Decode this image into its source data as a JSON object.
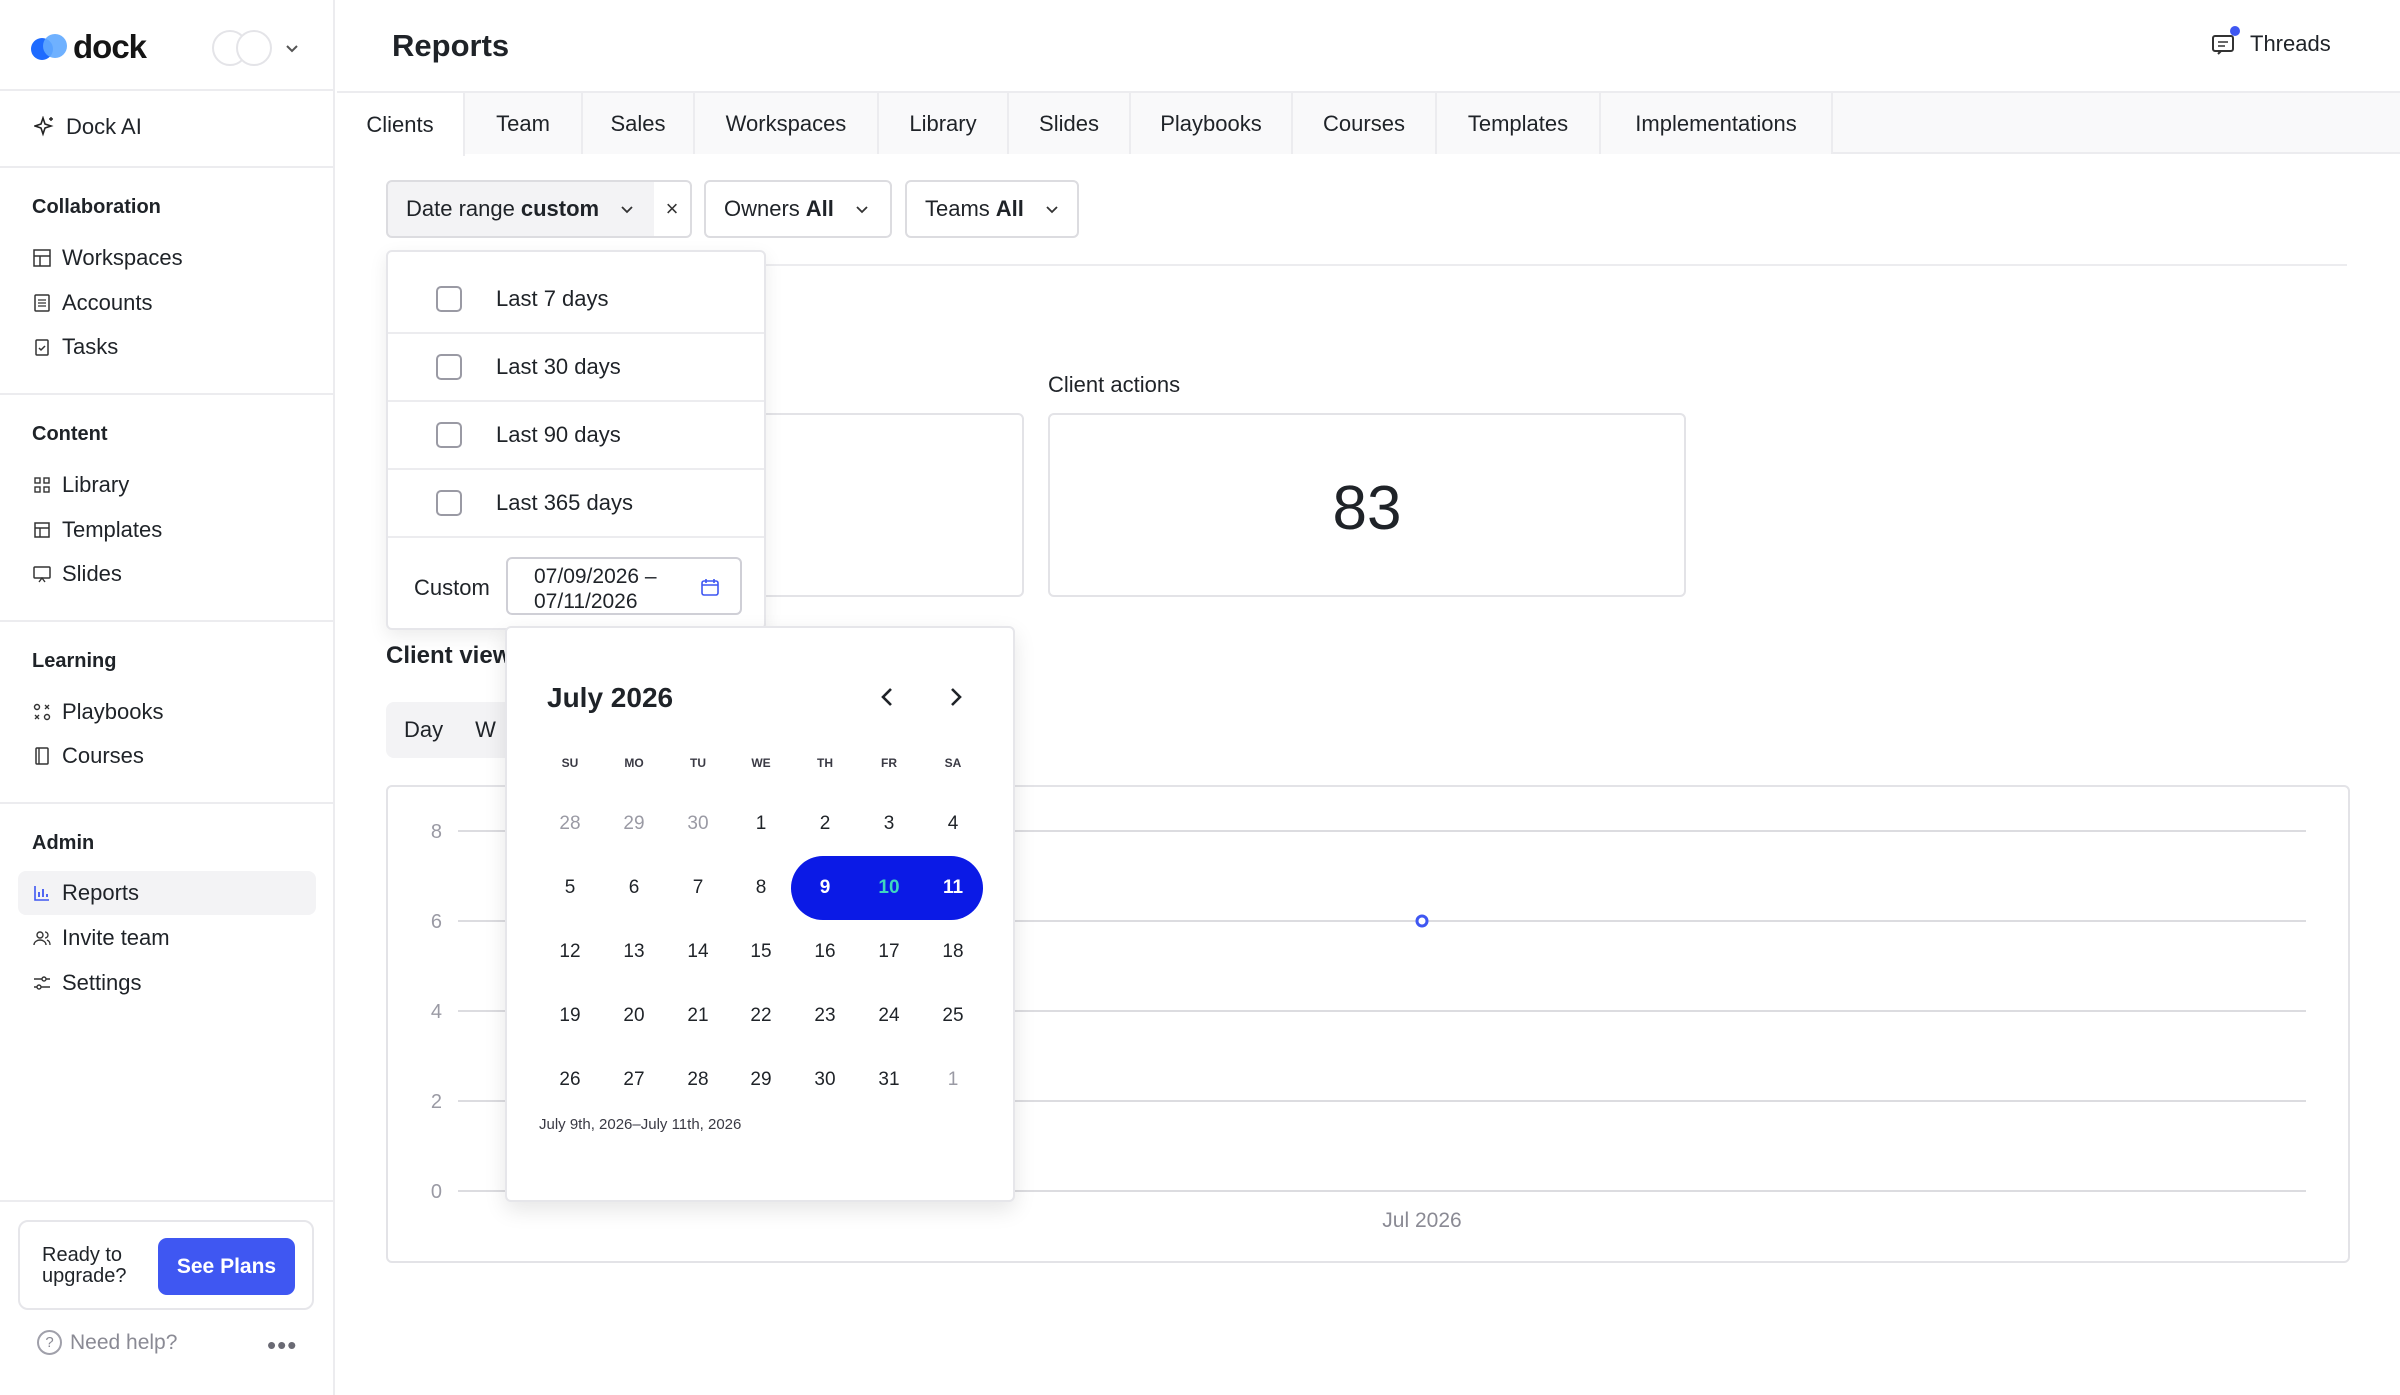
{
  "brand": {
    "name": "dock"
  },
  "sidebar": {
    "ai_label": "Dock AI",
    "sections": [
      {
        "title": "Collaboration",
        "items": [
          "Workspaces",
          "Accounts",
          "Tasks"
        ]
      },
      {
        "title": "Content",
        "items": [
          "Library",
          "Templates",
          "Slides"
        ]
      },
      {
        "title": "Learning",
        "items": [
          "Playbooks",
          "Courses"
        ]
      },
      {
        "title": "Admin",
        "items": [
          "Reports",
          "Invite team",
          "Settings"
        ]
      }
    ],
    "active_item": "Reports",
    "upgrade": {
      "text_line1": "Ready to",
      "text_line2": "upgrade?",
      "button": "See Plans"
    },
    "help": "Need help?",
    "more": "•••"
  },
  "header": {
    "title": "Reports",
    "threads": "Threads"
  },
  "tabs": [
    "Clients",
    "Team",
    "Sales",
    "Workspaces",
    "Library",
    "Slides",
    "Playbooks",
    "Courses",
    "Templates",
    "Implementations"
  ],
  "active_tab": "Clients",
  "filters": {
    "date": {
      "label": "Date range",
      "value": "custom"
    },
    "clear": "×",
    "owners": {
      "label": "Owners",
      "value": "All"
    },
    "teams": {
      "label": "Teams",
      "value": "All"
    }
  },
  "date_dropdown": {
    "options": [
      "Last 7 days",
      "Last 30 days",
      "Last 90 days",
      "Last 365 days"
    ],
    "custom_label": "Custom",
    "custom_value_line1": "07/09/2026 –",
    "custom_value_line2": "07/11/2026"
  },
  "calendar": {
    "month": "July 2026",
    "weekdays": [
      "SU",
      "MO",
      "TU",
      "WE",
      "TH",
      "FR",
      "SA"
    ],
    "weeks": [
      [
        "28",
        "29",
        "30",
        "1",
        "2",
        "3",
        "4"
      ],
      [
        "5",
        "6",
        "7",
        "8",
        "9",
        "10",
        "11"
      ],
      [
        "12",
        "13",
        "14",
        "15",
        "16",
        "17",
        "18"
      ],
      [
        "19",
        "20",
        "21",
        "22",
        "23",
        "24",
        "25"
      ],
      [
        "26",
        "27",
        "28",
        "29",
        "30",
        "31",
        "1"
      ]
    ],
    "selected_range_text": "July 9th, 2026–July 11th, 2026"
  },
  "metrics": {
    "client_actions": {
      "title": "Client actions",
      "value": "83"
    }
  },
  "chart_section": {
    "title": "Client view",
    "segments": [
      "Day",
      "W"
    ]
  },
  "chart_data": {
    "type": "line",
    "x": [
      "Jul 2026"
    ],
    "series": [
      {
        "values": [
          6
        ]
      }
    ],
    "ylim": [
      0,
      8
    ],
    "yticks": [
      "0",
      "2",
      "4",
      "6",
      "8"
    ],
    "xticks": [
      "Jul 2026"
    ],
    "grid": true
  },
  "colors": {
    "accent": "#3f57f2",
    "range": "#0b1ae6",
    "range_mid_text": "#3fd6c0"
  }
}
